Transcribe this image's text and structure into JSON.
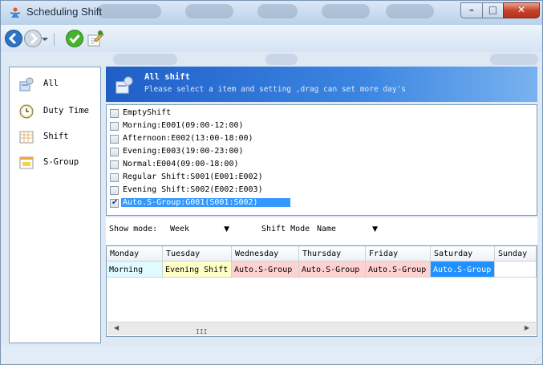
{
  "window": {
    "title": "Scheduling Shift"
  },
  "toolbar": {
    "back": "back-icon",
    "forward": "forward-icon",
    "confirm": "check-icon",
    "edit": "edit-icon"
  },
  "sidebar": {
    "items": [
      {
        "label": "All",
        "icon": "all-shifts-icon"
      },
      {
        "label": "Duty Time",
        "icon": "clock-icon"
      },
      {
        "label": "Shift",
        "icon": "shift-grid-icon"
      },
      {
        "label": "S-Group",
        "icon": "shift-group-icon"
      }
    ]
  },
  "banner": {
    "title": "All shift",
    "subtitle": "Please select a item and setting ,drag can set more day's"
  },
  "shifts": [
    {
      "label": "EmptyShift",
      "checked": false
    },
    {
      "label": "Morning:E001(09:00-12:00)",
      "checked": false
    },
    {
      "label": "Afternoon:E002(13:00-18:00)",
      "checked": false
    },
    {
      "label": "Evening:E003(19:00-23:00)",
      "checked": false
    },
    {
      "label": "Normal:E004(09:00-18:00)",
      "checked": false
    },
    {
      "label": "Regular Shift:S001(E001:E002)",
      "checked": false
    },
    {
      "label": "Evening Shift:S002(E002:E003)",
      "checked": false
    },
    {
      "label": "Auto.S-Group:G001(S001:S002)",
      "checked": true
    }
  ],
  "modes": {
    "show_label": "Show mode:",
    "show_value": "Week",
    "shift_label": "Shift Mode",
    "shift_value": "Name"
  },
  "week": {
    "headers": [
      "Monday",
      "Tuesday",
      "Wednesday",
      "Thursday",
      "Friday",
      "Saturday",
      "Sunday"
    ],
    "cells": [
      "Morning",
      "Evening Shift",
      "Auto.S-Group",
      "Auto.S-Group",
      "Auto.S-Group",
      "Auto.S-Group",
      ""
    ],
    "cell_colors": [
      "#e0fbff",
      "#ffffc8",
      "#ffd2d2",
      "#ffd2d2",
      "#ffd2d2",
      "#1e90ff",
      "#ffffff"
    ]
  },
  "scroll": {
    "thumb": "III"
  }
}
